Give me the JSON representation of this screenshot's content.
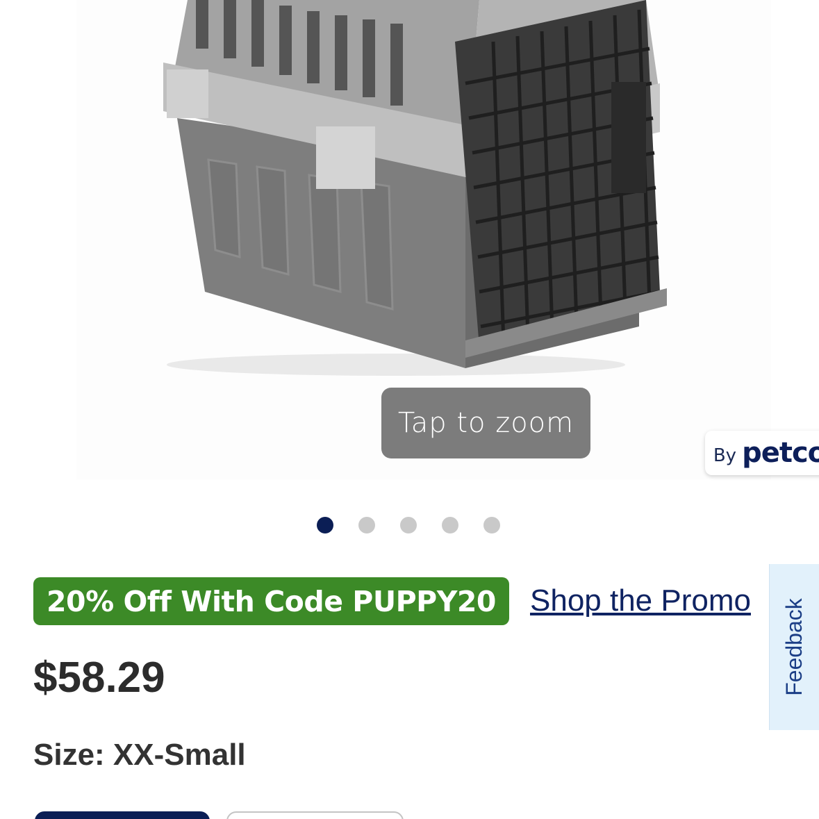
{
  "gallery": {
    "zoom_label": "Tap to zoom",
    "brand_by": "By",
    "brand_name": "petco",
    "dot_count": 5,
    "active_index": 0
  },
  "promo": {
    "badge": "20% Off With Code PUPPY20",
    "link": "Shop the Promo",
    "badge_color": "#3c8a27"
  },
  "product": {
    "price": "$58.29",
    "size_label": "Size: XX-Small"
  },
  "feedback": {
    "label": "Feedback"
  },
  "colors": {
    "brand_navy": "#0b1e55",
    "link": "#0f2362"
  }
}
